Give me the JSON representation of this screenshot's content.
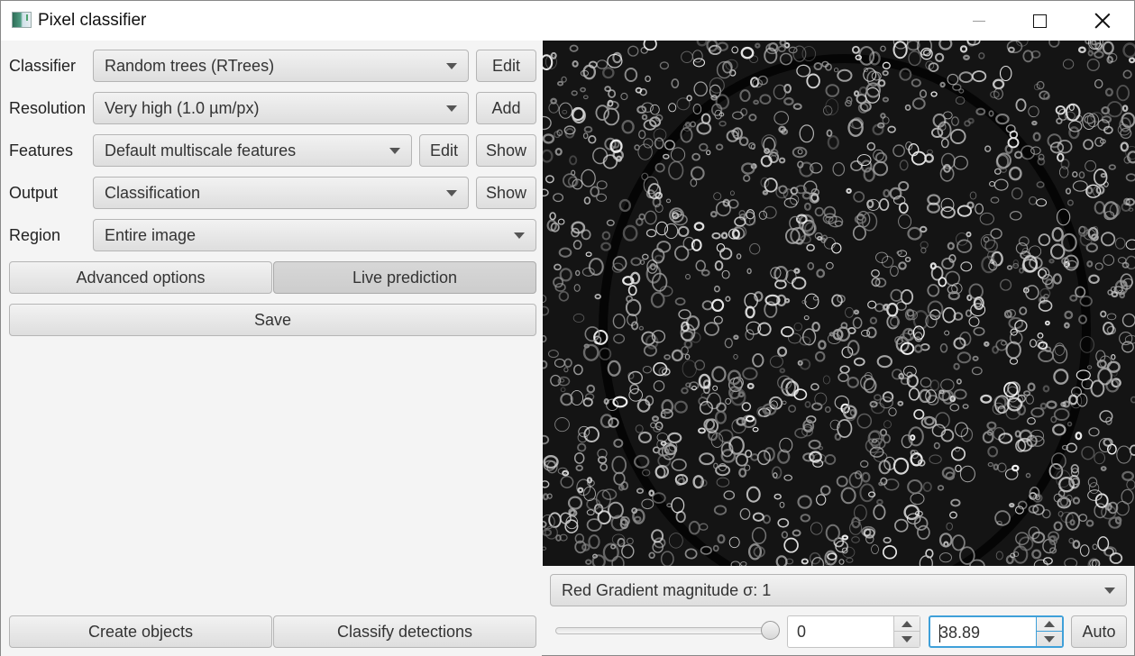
{
  "window": {
    "title": "Pixel classifier",
    "icon": "qupath-app-icon",
    "controls": {
      "minimize": "minimize-icon",
      "maximize": "maximize-icon",
      "close": "close-icon"
    }
  },
  "form": {
    "classifier": {
      "label": "Classifier",
      "value": "Random trees (RTrees)",
      "button": "Edit"
    },
    "resolution": {
      "label": "Resolution",
      "value": "Very high (1.0 µm/px)",
      "button": "Add"
    },
    "features": {
      "label": "Features",
      "value": "Default multiscale features",
      "edit_button": "Edit",
      "show_button": "Show"
    },
    "output": {
      "label": "Output",
      "value": "Classification",
      "button": "Show"
    },
    "region": {
      "label": "Region",
      "value": "Entire image"
    }
  },
  "actions": {
    "advanced_options": "Advanced options",
    "live_prediction": "Live prediction",
    "live_prediction_active": true,
    "save": "Save",
    "create_objects": "Create objects",
    "classify_detections": "Classify detections"
  },
  "viewer": {
    "image_description": "Gradient magnitude feature image of tissue (grayscale)",
    "channel_value": "Red Gradient magnitude σ: 1"
  },
  "display_range": {
    "slider_position_percent": 100,
    "min_value": "0",
    "max_value": "38.89",
    "auto_button": "Auto"
  },
  "colors": {
    "focus_border": "#3fa0d9",
    "panel_bg": "#f4f4f4",
    "image_bg": "#0d0d0d"
  }
}
